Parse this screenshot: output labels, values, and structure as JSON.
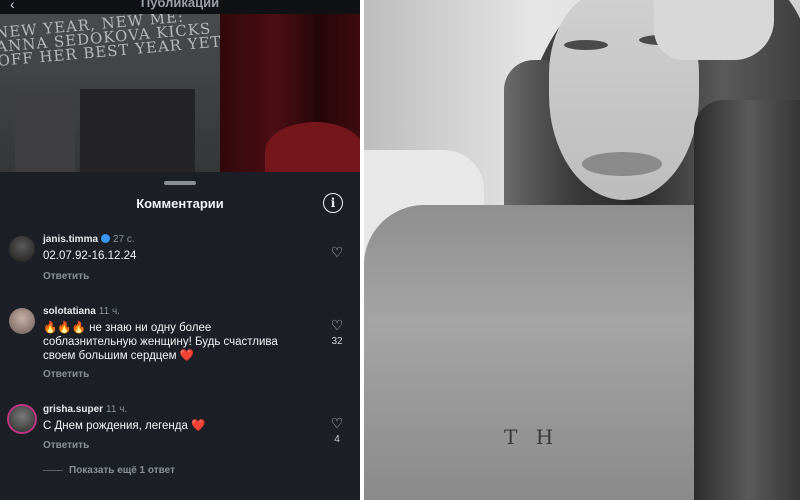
{
  "header": {
    "back_icon": "back-arrow-icon",
    "title": "Публикации"
  },
  "post": {
    "headline": "NEW YEAR, NEW ME: ANNA SEDOKOVA KICKS OFF HER BEST YEAR YET"
  },
  "comments_sheet": {
    "title": "Комментарии",
    "info_icon": "info-icon",
    "comments": [
      {
        "username": "janis.timma",
        "verified": true,
        "time": "27 с.",
        "text": "02.07.92-16.12.24",
        "reply_label": "Ответить",
        "likes": ""
      },
      {
        "username": "solotatiana",
        "verified": false,
        "time": "11 ч.",
        "text_emoji": "🔥🔥🔥",
        "text": "не знаю ни одну более соблазнительную женщину! Будь счастлива своем большим сердцем",
        "text_end_emoji": "❤️",
        "reply_label": "Ответить",
        "likes": "32"
      },
      {
        "username": "grisha.super",
        "verified": false,
        "time": "11 ч.",
        "text": "С Днем рождения, легенда",
        "text_end_emoji": "❤️",
        "reply_label": "Ответить",
        "likes": "4"
      }
    ],
    "more_replies": "Показать ещё 1 ответ"
  },
  "photo": {
    "print_text": "T H"
  },
  "colors": {
    "background": "#1c2026",
    "verified": "#3897f0",
    "heart_red": "#e0222b"
  }
}
